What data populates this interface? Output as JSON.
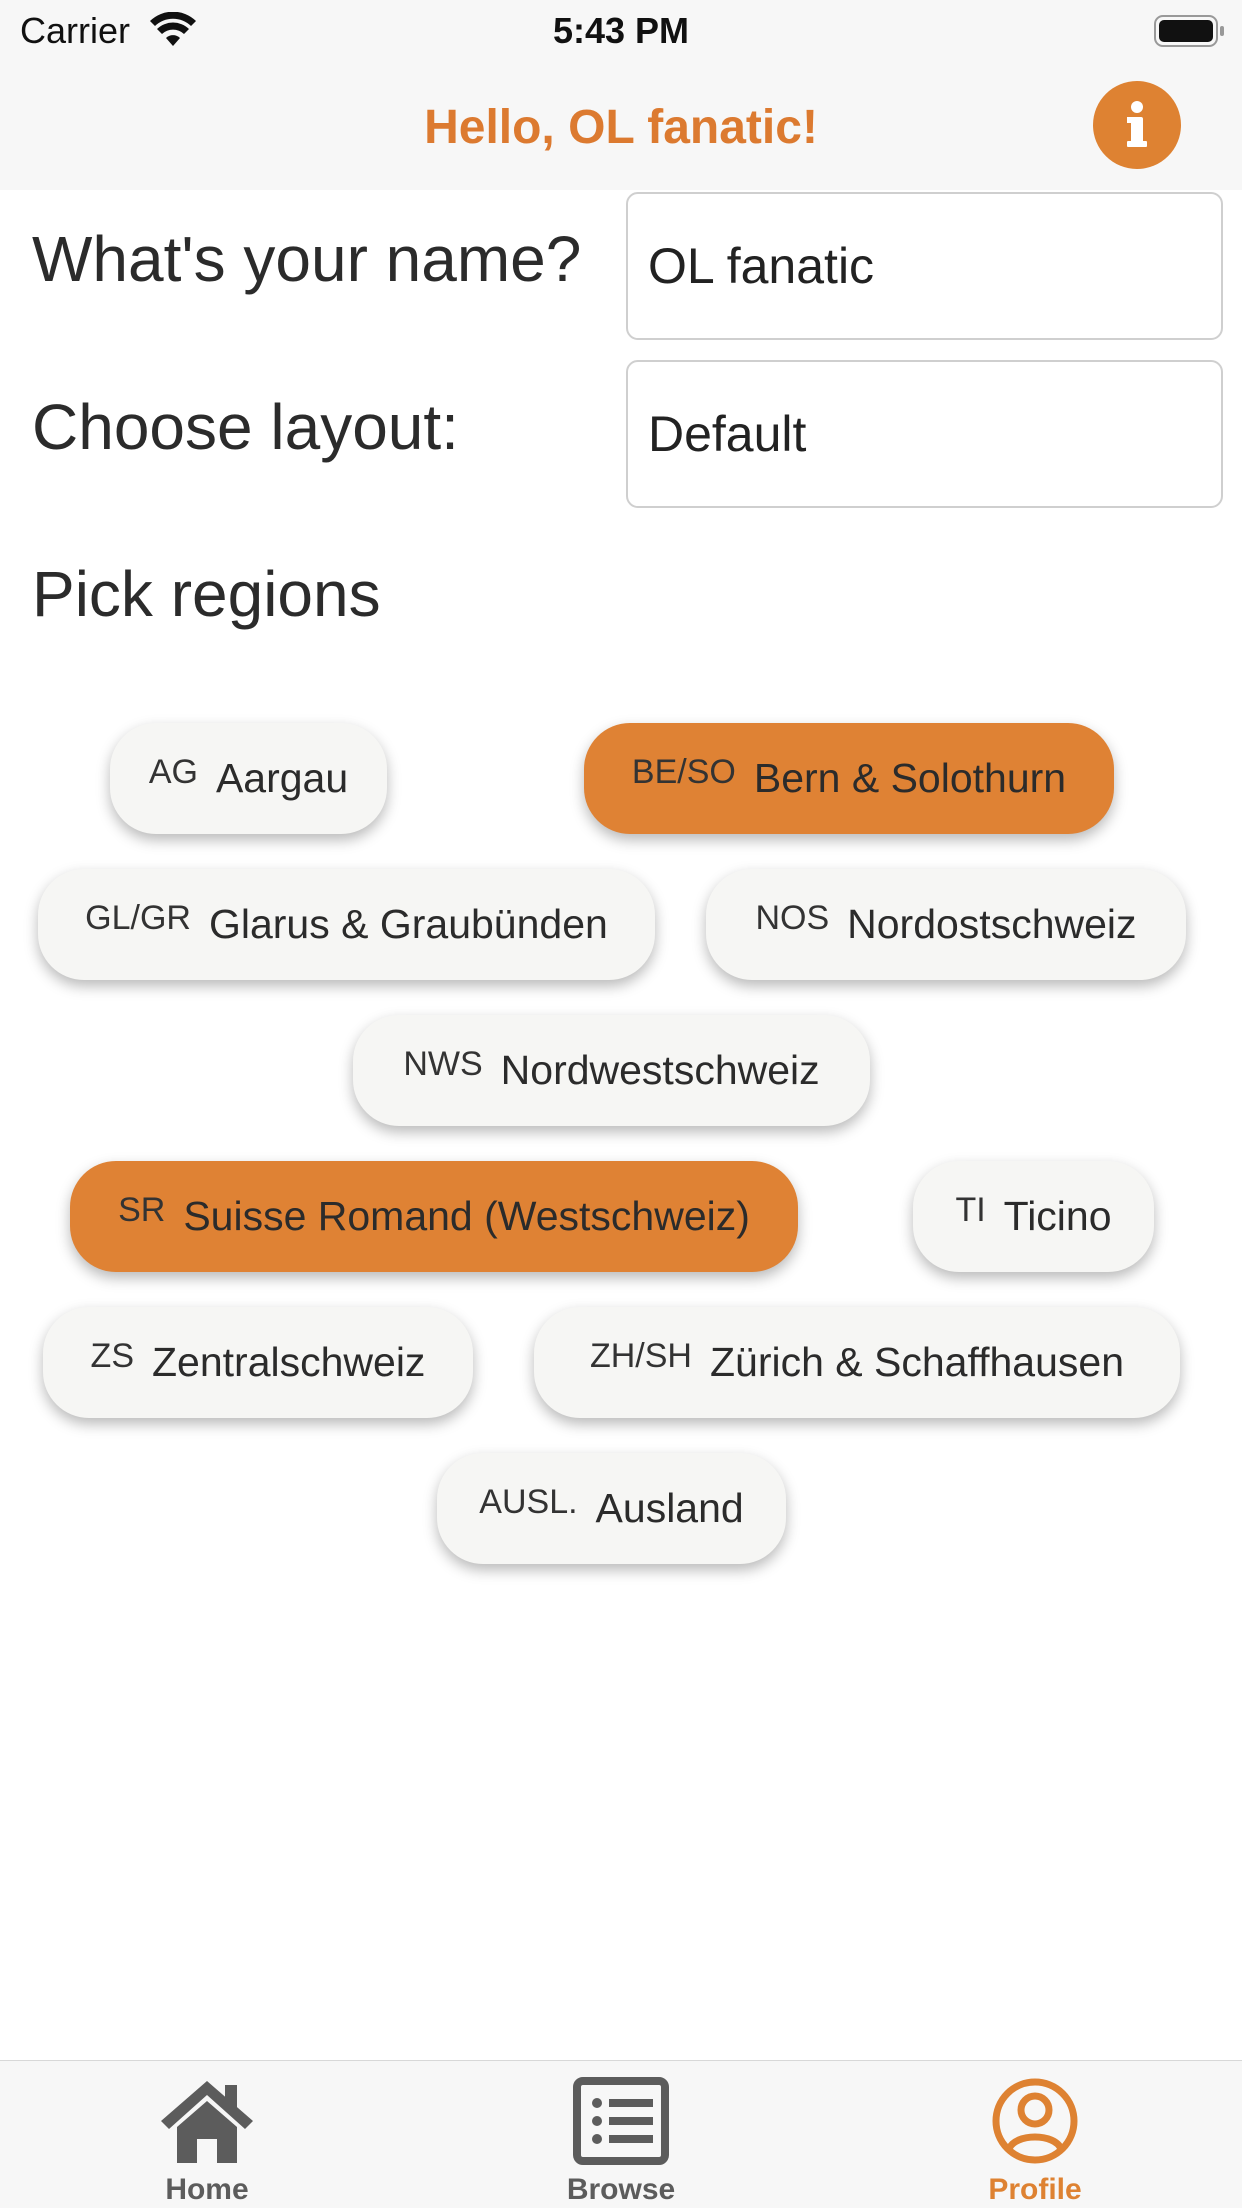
{
  "status_bar": {
    "carrier": "Carrier",
    "time": "5:43 PM"
  },
  "nav": {
    "title": "Hello, OL fanatic!",
    "info_icon": "info-icon"
  },
  "form": {
    "name_label": "What's your name?",
    "name_value": "OL fanatic",
    "layout_label": "Choose layout:",
    "layout_value": "Default"
  },
  "regions": {
    "title": "Pick regions",
    "items": [
      {
        "abbr": "AG",
        "name": "Aargau",
        "selected": false
      },
      {
        "abbr": "BE/SO",
        "name": "Bern & Solothurn",
        "selected": true
      },
      {
        "abbr": "GL/GR",
        "name": "Glarus & Graubünden",
        "selected": false
      },
      {
        "abbr": "NOS",
        "name": "Nordostschweiz",
        "selected": false
      },
      {
        "abbr": "NWS",
        "name": "Nordwestschweiz",
        "selected": false
      },
      {
        "abbr": "SR",
        "name": "Suisse Romand (Westschweiz)",
        "selected": true
      },
      {
        "abbr": "TI",
        "name": "Ticino",
        "selected": false
      },
      {
        "abbr": "ZS",
        "name": "Zentralschweiz",
        "selected": false
      },
      {
        "abbr": "ZH/SH",
        "name": "Zürich & Schaffhausen",
        "selected": false
      },
      {
        "abbr": "AUSL.",
        "name": "Ausland",
        "selected": false
      }
    ]
  },
  "tabs": [
    {
      "label": "Home",
      "icon": "home-icon",
      "active": false
    },
    {
      "label": "Browse",
      "icon": "list-icon",
      "active": false
    },
    {
      "label": "Profile",
      "icon": "user-circle-icon",
      "active": true
    }
  ],
  "colors": {
    "accent": "#de8232",
    "chip_bg": "#f6f6f4",
    "inactive_tab": "#5c5c5c"
  }
}
